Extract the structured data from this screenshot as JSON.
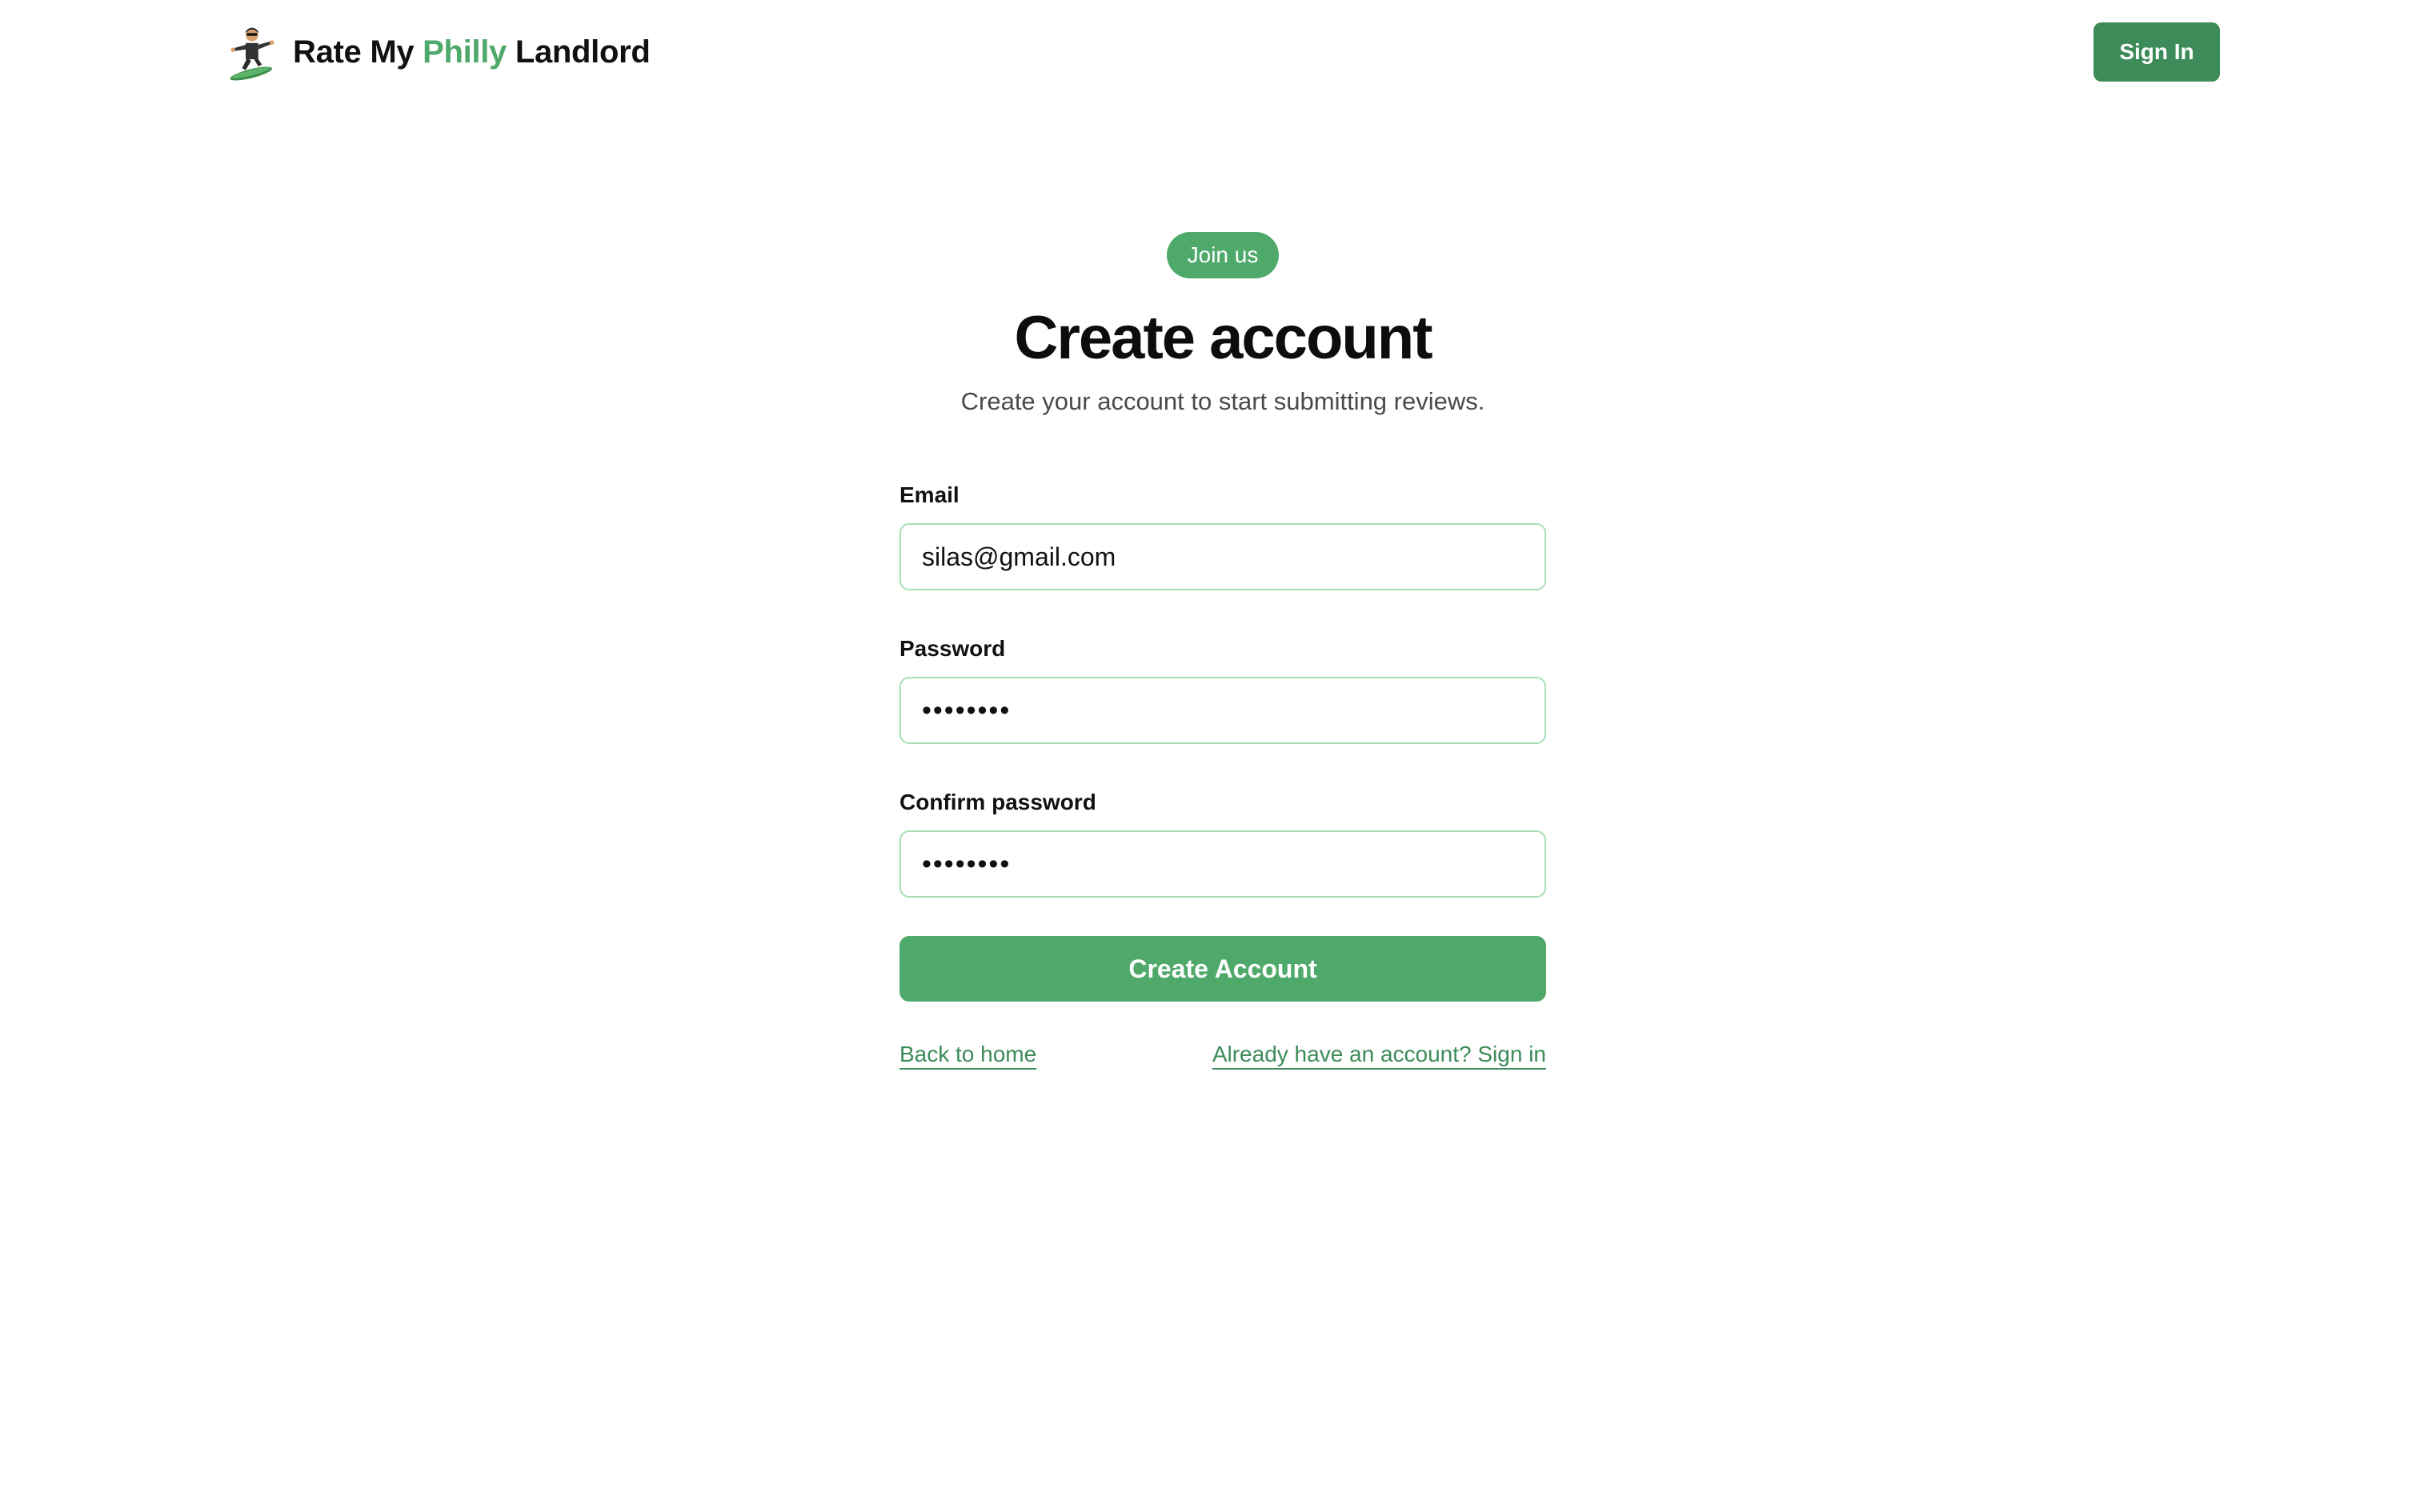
{
  "header": {
    "brand": {
      "prefix": "Rate My ",
      "accent": "Philly",
      "suffix": " Landlord"
    },
    "logo_icon": "snowboarder-icon",
    "signin_label": "Sign In"
  },
  "badge": "Join us",
  "title": "Create account",
  "subtitle": "Create your account to start submitting reviews.",
  "form": {
    "email": {
      "label": "Email",
      "value": "silas@gmail.com"
    },
    "password": {
      "label": "Password",
      "value": "••••••••"
    },
    "confirm": {
      "label": "Confirm password",
      "value": "••••••••"
    },
    "submit_label": "Create Account"
  },
  "links": {
    "back": "Back to home",
    "signin": "Already have an account? Sign in"
  },
  "colors": {
    "accent": "#4fa96b",
    "accent_dark": "#3d8b58",
    "input_border": "#a7dfb5"
  }
}
